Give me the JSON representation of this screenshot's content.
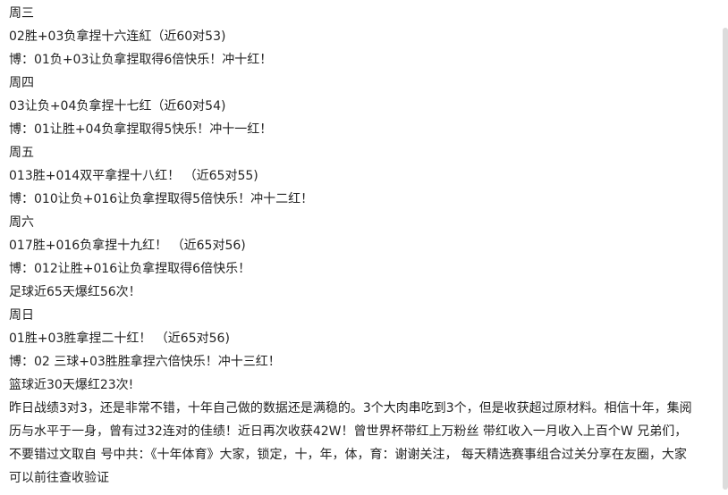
{
  "lines": [
    "周三",
    "02胜+03负拿捏十六连紅（近60对53)",
    "博：01负+03让负拿捏取得6倍快乐！冲十红！",
    "周四",
    "03让负+04负拿捏十七红（近60对54)",
    "博：01让胜+04负拿捏取得5快乐！冲十一红！",
    "周五",
    "013胜+014双平拿捏十八红！ （近65对55)",
    "博：010让负+016让负拿捏取得5倍快乐！冲十二红！",
    "周六",
    "017胜+016负拿捏十九红！ （近65对56)",
    "博：012让胜+016让负拿捏取得6倍快乐！",
    "足球近65天爆红56次！",
    "周日",
    "01胜+03胜拿捏二十红！ （近65对56)",
    "博：02 三球+03胜胜拿捏六倍快乐！冲十三红！",
    "篮球近30天爆红23次!"
  ],
  "paragraph": "昨日战绩3对3，还是非常不错，十年自己做的数据还是满稳的。3个大肉串吃到3个，但是收获超过原材料。相信十年，集阅历与水平于一身，曾有过32连对的佳绩！近日再次收获42W！曾世界杯带红上万粉丝 带红收入一月收入上百个W 兄弟们，不要错过文取自 号中共：《十年体育》大家，锁定，十，年，体，育：谢谢关注， 每天精选赛事组合过关分享在友圈，大家可以前往查收验证"
}
